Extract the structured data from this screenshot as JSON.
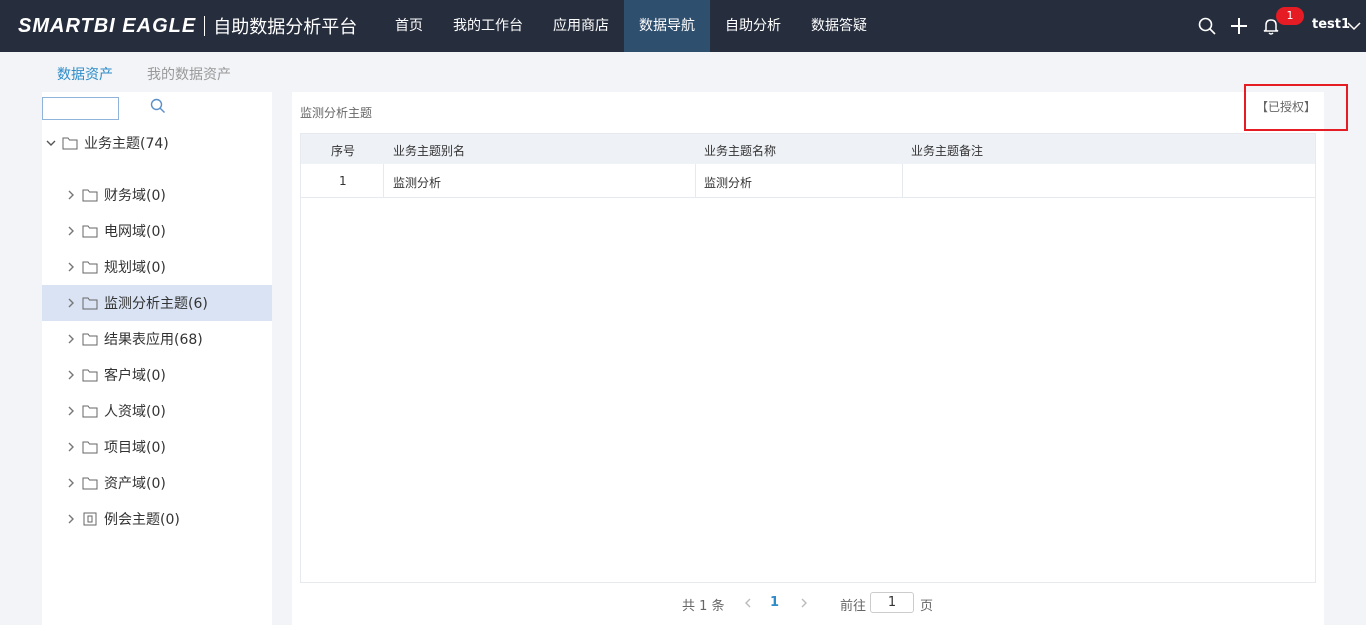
{
  "brand": {
    "logo": "SMARTBI EAGLE",
    "product": "自助数据分析平台"
  },
  "nav": [
    "首页",
    "我的工作台",
    "应用商店",
    "数据导航",
    "自助分析",
    "数据答疑"
  ],
  "nav_active": "数据导航",
  "topbar": {
    "notification_count": "1",
    "username": "test1"
  },
  "subtabs": [
    "数据资产",
    "我的数据资产"
  ],
  "tree": {
    "root": "业务主题(74)",
    "items": [
      "财务域(0)",
      "电网域(0)",
      "规划域(0)",
      "监测分析主题(6)",
      "结果表应用(68)",
      "客户域(0)",
      "人资域(0)",
      "项目域(0)",
      "资产域(0)",
      "例会主题(0)"
    ]
  },
  "panel": {
    "title": "监测分析主题",
    "auth": "【已授权】"
  },
  "table": {
    "headers": [
      "序号",
      "业务主题别名",
      "业务主题名称",
      "业务主题备注"
    ],
    "rows": [
      [
        "1",
        "监测分析",
        "监测分析",
        ""
      ]
    ]
  },
  "pagination": {
    "total": "共 1 条",
    "current_page": "1",
    "goto_label": "前往",
    "goto_value": "1",
    "page_suffix": "页"
  },
  "colors": {
    "topbar": "#262d3d",
    "active_nav": "#2f4f6f",
    "accent": "#2d8cc9",
    "badge": "#e51c23",
    "selected_row": "#d9e3f3"
  }
}
